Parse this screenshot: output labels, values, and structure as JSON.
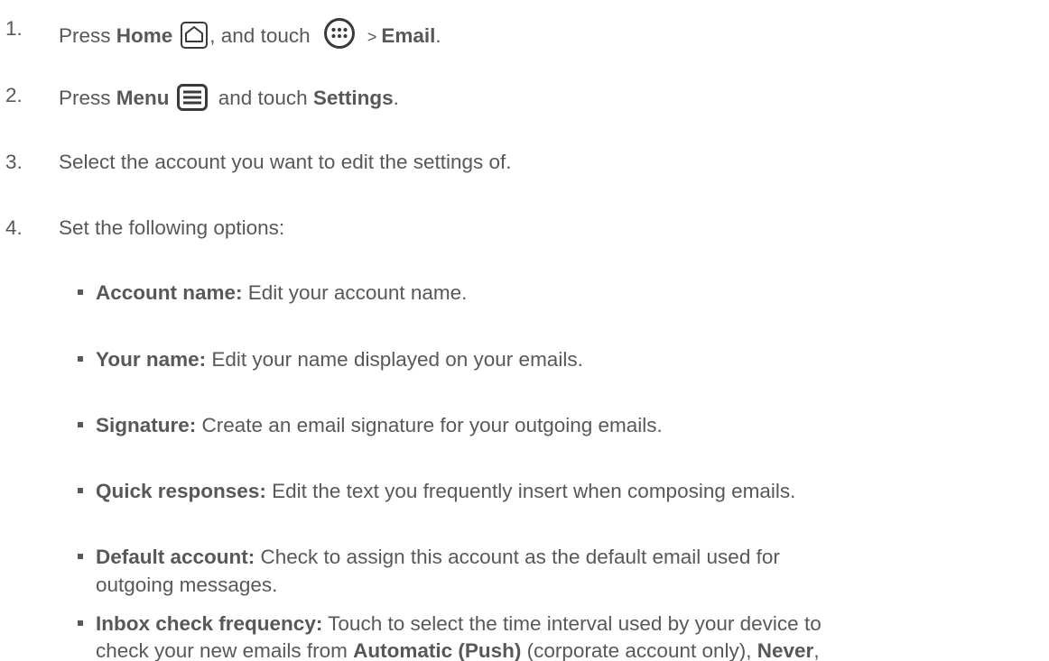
{
  "steps": [
    {
      "num": "1.",
      "pre": "Press ",
      "b1": "Home",
      "mid": ", and touch ",
      "sep": " > ",
      "b2": "Email",
      "end": ".",
      "icons": [
        "home-icon",
        "apps-icon"
      ]
    },
    {
      "num": "2.",
      "pre": "Press ",
      "b1": "Menu",
      "mid": " and touch ",
      "b2": "Settings",
      "end": ".",
      "icons": [
        "menu-icon"
      ]
    },
    {
      "num": "3.",
      "text": "Select the account you want to edit the settings of."
    },
    {
      "num": "4.",
      "text": "Set the following options:"
    }
  ],
  "options": [
    {
      "label": "Account name:",
      "desc": " Edit your account name."
    },
    {
      "label": "Your name:",
      "desc": " Edit your name displayed on your emails."
    },
    {
      "label": "Signature:",
      "desc": " Create an email signature for your outgoing emails."
    },
    {
      "label": "Quick responses:",
      "desc": " Edit the text you frequently insert when composing emails."
    },
    {
      "label": "Default account:",
      "desc": " Check to assign this account as the default email used for",
      "desc2": "outgoing messages."
    },
    {
      "label": "Inbox check frequency:",
      "desc": " Touch to select the time interval used by your device to",
      "desc2a": "check your new emails from ",
      "b_auto": "Automatic (Push)",
      "desc2b": " (corporate account only), ",
      "b_never": "Never",
      "desc2c": ","
    }
  ]
}
